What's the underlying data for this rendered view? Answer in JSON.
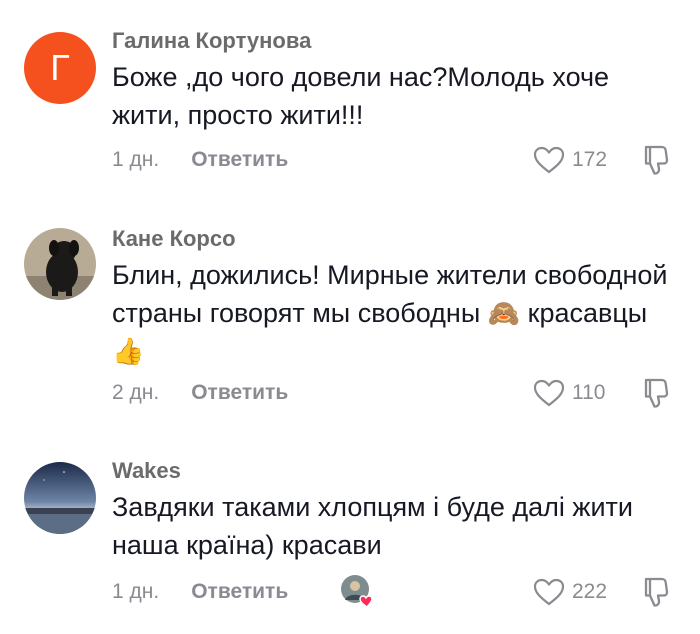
{
  "comments": [
    {
      "avatar_letter": "Г",
      "username": "Галина Кортунова",
      "text": "Боже ,до чого довели нас?Молодь хоче жити, просто жити!!!",
      "time": "1 дн.",
      "reply_label": "Ответить",
      "likes": "172"
    },
    {
      "username": "Кане Корсо",
      "text_part1": "Блин, дожились! Мирные жители свободной страны говорят мы свободны",
      "emoji_monkey": "🙈",
      "text_part2": "красавцы",
      "emoji_thumb": "👍",
      "time": "2 дн.",
      "reply_label": "Ответить",
      "likes": "110"
    },
    {
      "username": "Wakes",
      "text": "Завдяки таками хлопцям і буде далі жити наша країна) красави",
      "time": "1 дн.",
      "reply_label": "Ответить",
      "likes": "222"
    }
  ],
  "colors": {
    "avatar_bg": "#f4511e",
    "meta_gray": "#8a8b91",
    "text": "#161823",
    "heart_badge": "#fe2c55"
  },
  "icons": [
    "heart-outline-icon",
    "dislike-icon",
    "creator-liked-heart-icon"
  ]
}
